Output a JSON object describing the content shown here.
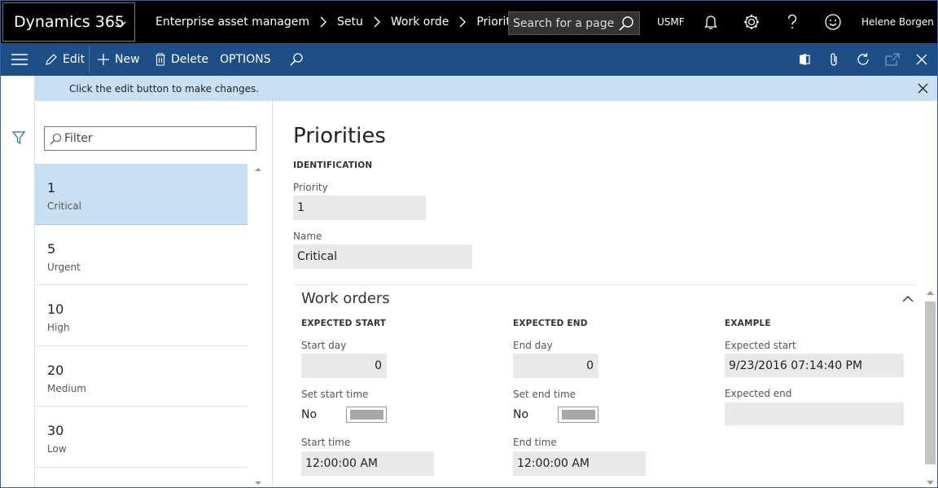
{
  "app": {
    "name": "Dynamics 365",
    "breadcrumbs": [
      "Enterprise asset managem",
      "Setu",
      "Work orde",
      "Priority"
    ],
    "search_placeholder": "Search for a page",
    "company": "USMF",
    "user": "Helene Borgen M"
  },
  "actions": {
    "edit": "Edit",
    "new": "New",
    "delete": "Delete",
    "options": "OPTIONS"
  },
  "message": "Click the edit button to make changes.",
  "list": {
    "filter_placeholder": "Filter",
    "items": [
      {
        "number": "1",
        "label": "Critical",
        "selected": true
      },
      {
        "number": "5",
        "label": "Urgent",
        "selected": false
      },
      {
        "number": "10",
        "label": "High",
        "selected": false
      },
      {
        "number": "20",
        "label": "Medium",
        "selected": false
      },
      {
        "number": "30",
        "label": "Low",
        "selected": false
      }
    ]
  },
  "details": {
    "title": "Priorities",
    "identification_header": "IDENTIFICATION",
    "priority_label": "Priority",
    "priority_value": "1",
    "name_label": "Name",
    "name_value": "Critical",
    "work_orders": {
      "title": "Work orders",
      "expected_start_header": "EXPECTED START",
      "start_day_label": "Start day",
      "start_day_value": "0",
      "set_start_time_label": "Set start time",
      "set_start_time_value": "No",
      "start_time_label": "Start time",
      "start_time_value": "12:00:00 AM",
      "expected_end_header": "EXPECTED END",
      "end_day_label": "End day",
      "end_day_value": "0",
      "set_end_time_label": "Set end time",
      "set_end_time_value": "No",
      "end_time_label": "End time",
      "end_time_value": "12:00:00 AM",
      "example_header": "EXAMPLE",
      "expected_start_label": "Expected start",
      "expected_start_value": "9/23/2016 07:14:40 PM",
      "expected_end_label": "Expected end",
      "expected_end_value": ""
    }
  },
  "colors": {
    "topbar": "#000000",
    "actionbar": "#1e4e86",
    "message_bg": "#c7e0f4",
    "selected_row": "#c7e0f4",
    "field_bg": "#e9e9e9"
  }
}
